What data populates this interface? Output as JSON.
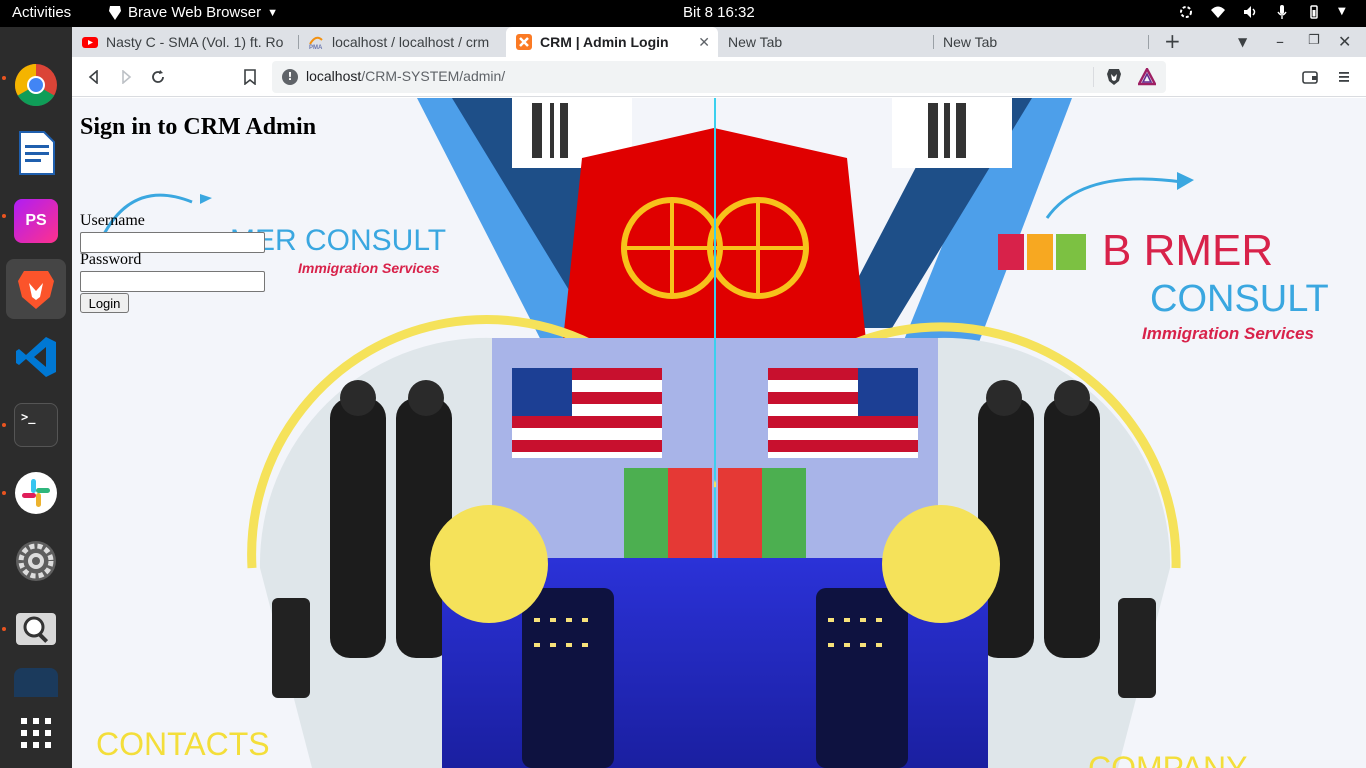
{
  "topbar": {
    "activities": "Activities",
    "app_menu": "Brave Web Browser",
    "clock": "Bit 8  16:32"
  },
  "dock": {
    "items": [
      {
        "name": "chrome-icon",
        "color": "#4285f4"
      },
      {
        "name": "libreoffice-writer-icon",
        "color": "#1f5fae"
      },
      {
        "name": "phpstorm-icon",
        "color": "#8a2be2"
      },
      {
        "name": "brave-icon",
        "color": "#fb542b"
      },
      {
        "name": "vscode-icon",
        "color": "#0078d4"
      },
      {
        "name": "terminal-icon",
        "color": "#333333"
      },
      {
        "name": "slack-icon",
        "color": "#ffffff"
      },
      {
        "name": "settings-icon",
        "color": "#6a6a6a"
      },
      {
        "name": "screenshot-icon",
        "color": "#d8d8d8"
      },
      {
        "name": "show-apps-icon",
        "color": "#ffffff"
      }
    ]
  },
  "tabs": [
    {
      "label": "Nasty C - SMA (Vol. 1) ft. Ro",
      "favicon": "youtube-icon"
    },
    {
      "label": "localhost / localhost / crm",
      "favicon": "phpmyadmin-icon"
    },
    {
      "label": "CRM | Admin Login",
      "favicon": "xampp-icon"
    },
    {
      "label": "New Tab",
      "favicon": ""
    },
    {
      "label": "New Tab",
      "favicon": ""
    }
  ],
  "address_bar": {
    "host": "localhost",
    "path": "/CRM-SYSTEM/admin/"
  },
  "page": {
    "heading": "Sign in to CRM Admin",
    "username_label": "Username",
    "password_label": "Password",
    "username_value": "",
    "password_value": "",
    "login_button": "Login"
  },
  "background": {
    "brand_left": "MER CONSULT",
    "brand_left_sub": "Immigration Services",
    "brand_right_top": "B RMER",
    "brand_right_bottom": "CONSULT",
    "brand_right_sub": "Immigration Services",
    "contacts": "CONTACTS",
    "company": "COMPANY"
  },
  "colors": {
    "accent_red": "#e00000",
    "accent_yellow": "#f5e25a",
    "brand_blue": "#3aa7e0",
    "brand_pink": "#d8224a"
  }
}
